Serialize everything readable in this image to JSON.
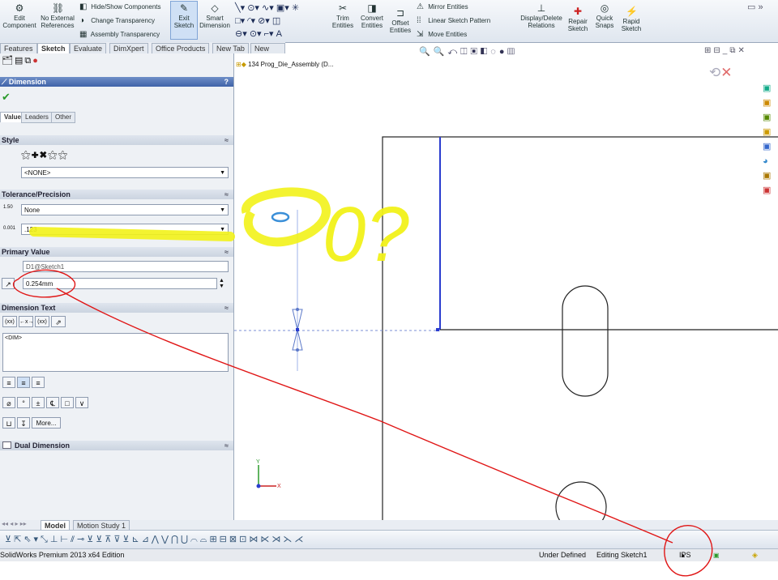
{
  "ribbon": {
    "edit_component": "Edit Component",
    "no_external": "No External References",
    "hide_show": "Hide/Show Components",
    "change_transparency": "Change Transparency",
    "assembly_transparency": "Assembly Transparency",
    "exit_sketch": "Exit Sketch",
    "smart_dimension": "Smart Dimension",
    "trim": "Trim Entities",
    "convert": "Convert Entities",
    "offset": "Offset Entities",
    "mirror": "Mirror Entities",
    "linear_pattern": "Linear Sketch Pattern",
    "move": "Move Entities",
    "display_delete": "Display/Delete Relations",
    "repair": "Repair Sketch",
    "quick_snaps": "Quick Snaps",
    "rapid": "Rapid Sketch"
  },
  "tabs": [
    "Features",
    "Sketch",
    "Evaluate",
    "DimXpert",
    "Office Products",
    "New Tab",
    "New Tab"
  ],
  "pm": {
    "title": "Dimension",
    "help": "?",
    "subtabs": [
      "Value",
      "Leaders",
      "Other"
    ],
    "style": {
      "header": "Style",
      "value": "<NONE>"
    },
    "tolerance": {
      "header": "Tolerance/Precision",
      "type": "None",
      "precision": ".123"
    },
    "primary": {
      "header": "Primary Value",
      "name": "D1@Sketch1",
      "value": "0.254mm"
    },
    "dimtext": {
      "header": "Dimension Text",
      "buttons": [
        "(xx)",
        "←x→",
        "(xx)",
        ""
      ],
      "text": "<DIM>",
      "more": "More..."
    },
    "dual": "Dual Dimension"
  },
  "canvas": {
    "tree_label": "134 Prog_Die_Assembly (D..."
  },
  "bottom": {
    "tabs": [
      "Model",
      "Motion Study 1"
    ]
  },
  "status": {
    "edition": "SolidWorks Premium 2013 x64 Edition",
    "defined": "Under Defined",
    "editing": "Editing Sketch1",
    "units": "IPS"
  },
  "annotation": {
    "text": "0?"
  }
}
